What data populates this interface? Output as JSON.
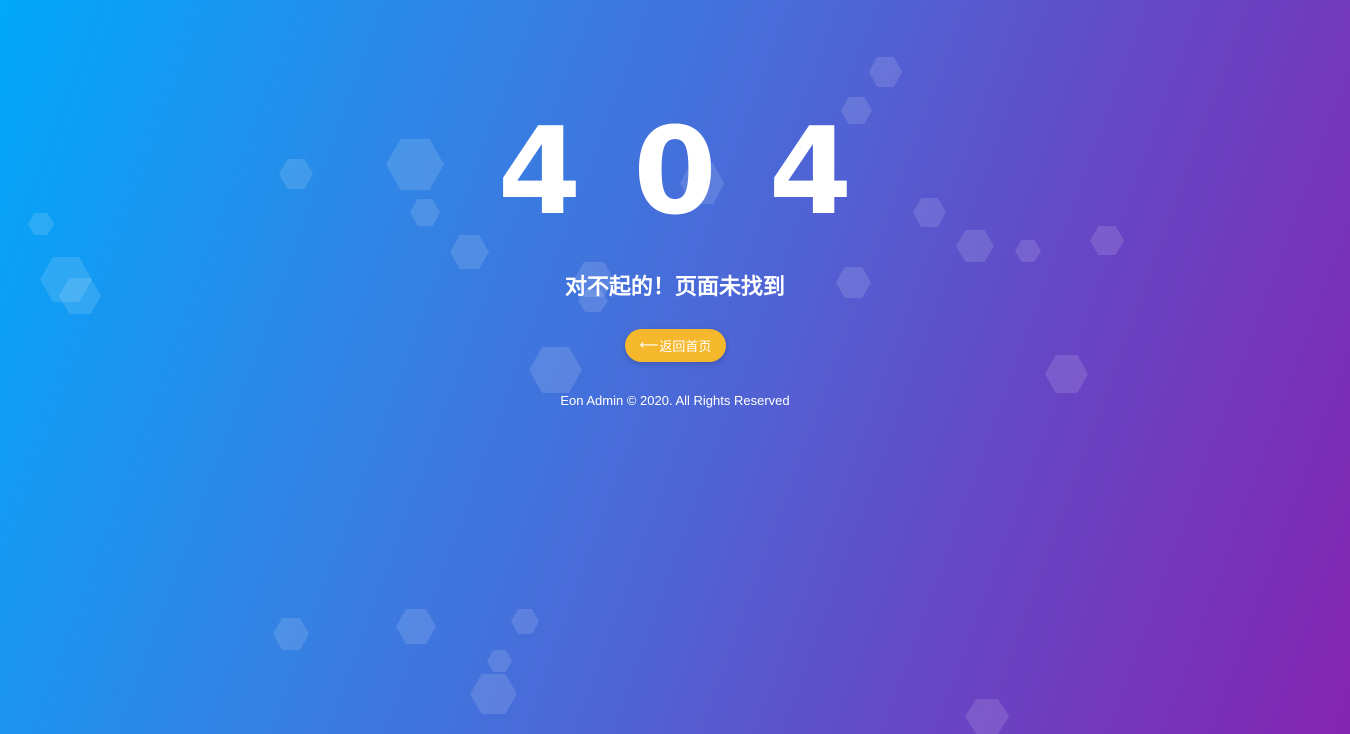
{
  "error": {
    "code": "404",
    "message": "对不起的！页面未找到"
  },
  "home_button": {
    "arrow": "⟵",
    "label": "返回首页"
  },
  "footer": {
    "text": "Eon Admin © 2020. All Rights Reserved"
  },
  "colors": {
    "gradient_start": "#00a8fb",
    "gradient_end": "#8424b2",
    "button": "#f5b72b",
    "text": "#ffffff"
  },
  "icons": {
    "background": "hexagon-pattern"
  }
}
